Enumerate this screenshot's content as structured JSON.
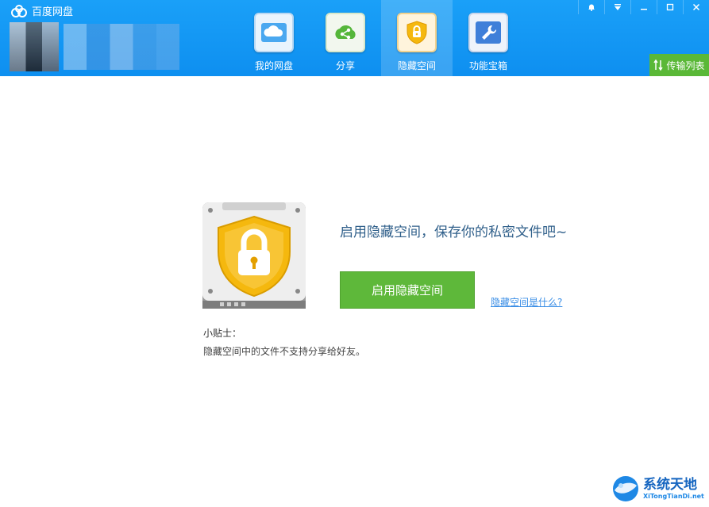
{
  "app": {
    "title": "百度网盘"
  },
  "nav": [
    {
      "label": "我的网盘",
      "icon": "cloud-icon"
    },
    {
      "label": "分享",
      "icon": "share-icon"
    },
    {
      "label": "隐藏空间",
      "icon": "lock-shield-icon",
      "active": true
    },
    {
      "label": "功能宝箱",
      "icon": "wrench-icon"
    }
  ],
  "window_controls": {
    "notify": "bell-icon",
    "menu": "menu-arrow-icon",
    "minimize": "minimize-icon",
    "maximize": "maximize-icon",
    "close": "close-icon"
  },
  "transfer": {
    "label": "传输列表",
    "icon": "transfer-arrows-icon"
  },
  "main": {
    "headline": "启用隐藏空间，保存你的私密文件吧~",
    "enable_button": "启用隐藏空间",
    "what_link": "隐藏空间是什么?",
    "tips_title": "小贴士：",
    "tips_text": "隐藏空间中的文件不支持分享给好友。"
  },
  "watermark": {
    "cn": "系统天地",
    "en": "XiTongTianDi.net"
  },
  "colors": {
    "topbar": "#1aa0f8",
    "accent_green": "#5eb83a",
    "link": "#3a8ee6",
    "headline": "#2f5f8a",
    "shield": "#f5b80e"
  }
}
